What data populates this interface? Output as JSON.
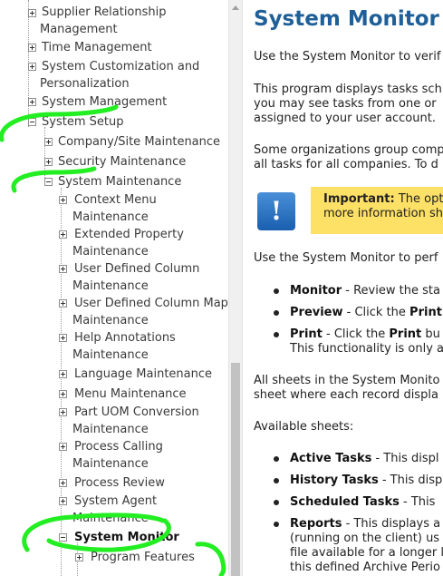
{
  "tree": {
    "items": [
      {
        "label": "Supplier Relationship"
      },
      {
        "label": "Management"
      },
      {
        "label": "Time Management"
      },
      {
        "label": "System Customization and"
      },
      {
        "label": "Personalization"
      },
      {
        "label": "System Management"
      },
      {
        "label": "System Setup"
      },
      {
        "label": "Company/Site Maintenance"
      },
      {
        "label": "Security Maintenance"
      },
      {
        "label": "System Maintenance"
      },
      {
        "label": "Context Menu"
      },
      {
        "label": "Maintenance"
      },
      {
        "label": "Extended Property"
      },
      {
        "label": "Maintenance"
      },
      {
        "label": "User Defined Column"
      },
      {
        "label": "Maintenance"
      },
      {
        "label": "User Defined Column Map"
      },
      {
        "label": "Maintenance"
      },
      {
        "label": "Help Annotations"
      },
      {
        "label": "Maintenance"
      },
      {
        "label": "Language Maintenance"
      },
      {
        "label": "Menu Maintenance"
      },
      {
        "label": "Part UOM Conversion"
      },
      {
        "label": "Maintenance"
      },
      {
        "label": "Process Calling"
      },
      {
        "label": "Maintenance"
      },
      {
        "label": "Process Review"
      },
      {
        "label": "System Agent"
      },
      {
        "label": "Maintenance"
      },
      {
        "label": "System Monitor"
      },
      {
        "label": "Program Features"
      }
    ]
  },
  "content": {
    "title": "System Monitor",
    "p1": "Use the System Monitor to verif",
    "p2": [
      "This program displays tasks sch",
      "you may see tasks from one or",
      "assigned to your user account."
    ],
    "p3": [
      "Some organizations group comp",
      "all tasks for all companies. To d"
    ],
    "important_label": "Important:",
    "important_text1": " The opt",
    "important_text2": "more information she",
    "p4": "Use the System Monitor to perf",
    "bullets1": [
      {
        "term": "Monitor",
        "text": " - Review the sta"
      },
      {
        "term": "Preview",
        "text": " - Click the ",
        "tail": "Print"
      },
      {
        "term": "Print",
        "text": " - Click the ",
        "tail": "Print",
        "rest": " bu",
        "line2": "This functionality is only a"
      }
    ],
    "p5": [
      "All sheets in the System Monito",
      "sheet where each record displa"
    ],
    "p6": "Available sheets:",
    "bullets2": [
      {
        "term": "Active Tasks",
        "text": " - This displ"
      },
      {
        "term": "History Tasks",
        "text": " - This disp"
      },
      {
        "term": "Scheduled Tasks",
        "text": " - This"
      },
      {
        "term": "Reports",
        "text": " - This displays a",
        "line2": "(running on the client) us",
        "line3": "file available for a longer l",
        "line4": "this defined Archive Perio"
      }
    ]
  },
  "colors": {
    "title": "#1f5f98",
    "important_bg": "#fde066",
    "annotation": "#22ee22"
  }
}
